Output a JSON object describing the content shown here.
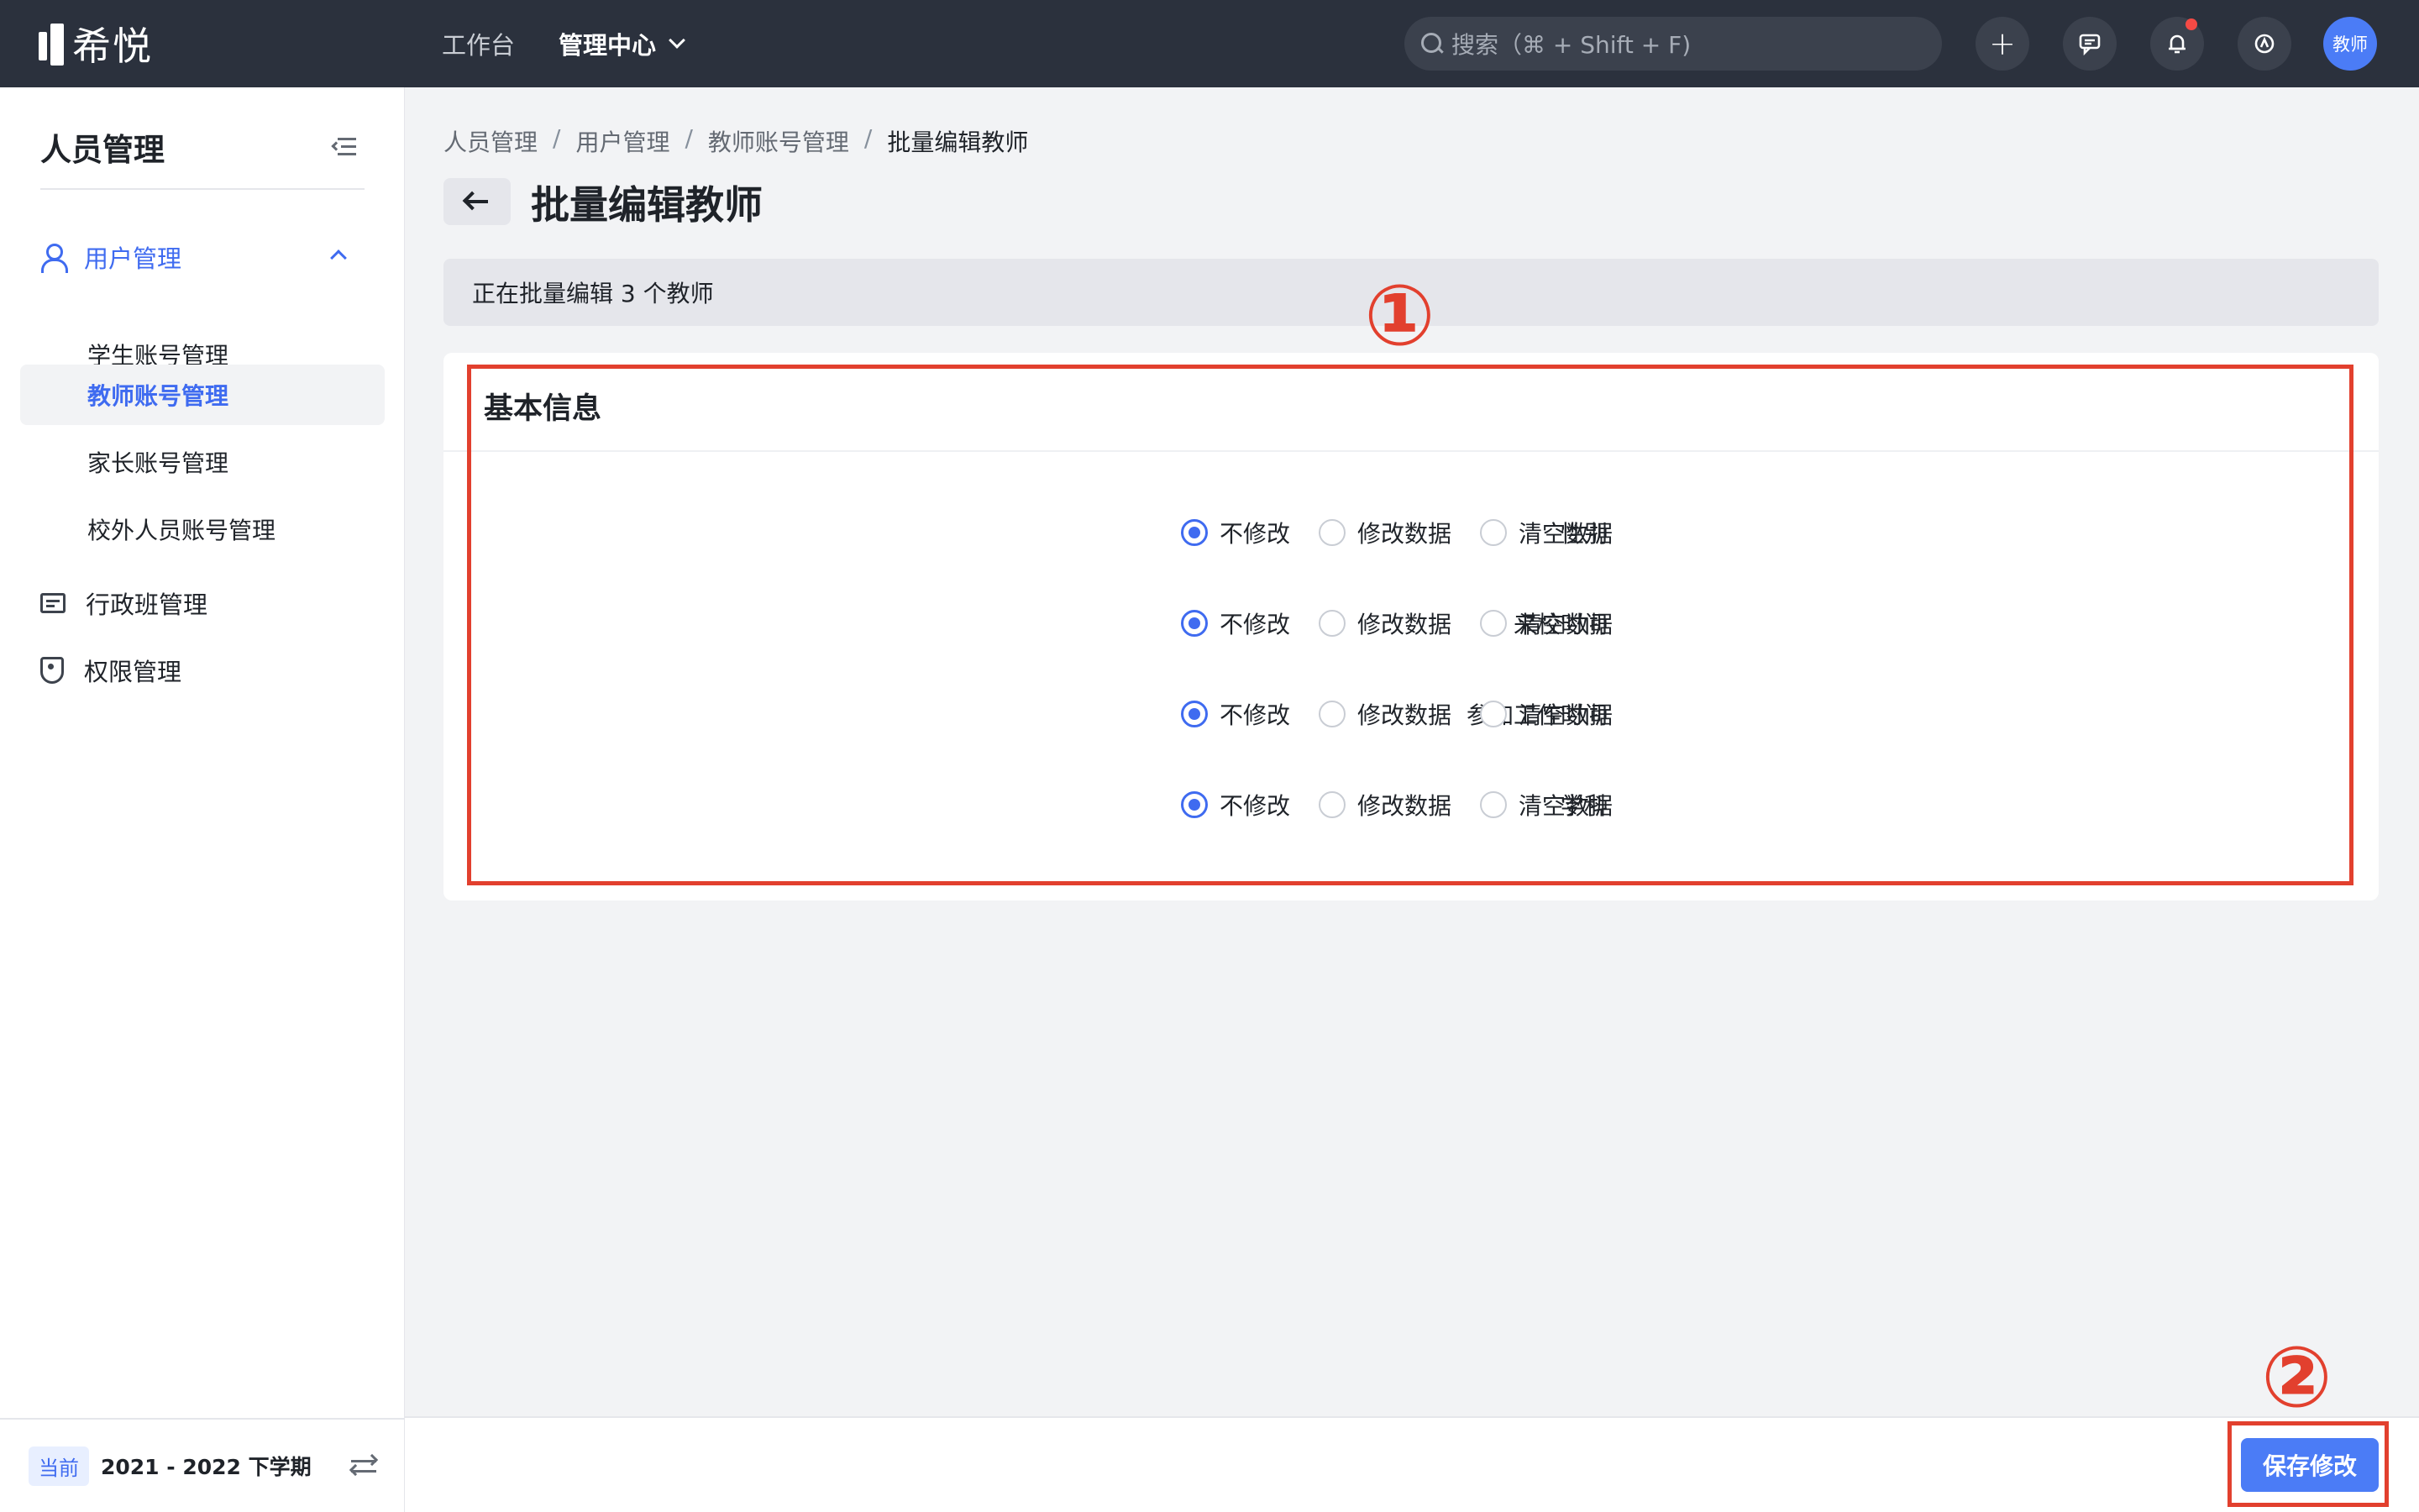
{
  "app": {
    "name": "希悦"
  },
  "topnav": {
    "items": [
      {
        "label": "工作台"
      },
      {
        "label": "管理中心"
      }
    ]
  },
  "search": {
    "placeholder": "搜索（⌘ + Shift + F)"
  },
  "user": {
    "avatar_label": "教师"
  },
  "sidebar": {
    "title": "人员管理",
    "group": {
      "label": "用户管理"
    },
    "sub_items": [
      {
        "label": "学生账号管理"
      },
      {
        "label": "教师账号管理"
      },
      {
        "label": "家长账号管理"
      },
      {
        "label": "校外人员账号管理"
      }
    ],
    "items": [
      {
        "label": "行政班管理",
        "icon": "class-icon"
      },
      {
        "label": "权限管理",
        "icon": "shield-icon"
      }
    ],
    "term": {
      "badge": "当前",
      "text": "2021 - 2022 下学期"
    }
  },
  "breadcrumb": [
    "人员管理",
    "用户管理",
    "教师账号管理",
    "批量编辑教师"
  ],
  "page": {
    "title": "批量编辑教师",
    "info": "正在批量编辑 3 个教师"
  },
  "card": {
    "title": "基本信息",
    "options": [
      "不修改",
      "修改数据",
      "清空数据"
    ],
    "fields": [
      {
        "label": "性别",
        "selected": "不修改"
      },
      {
        "label": "来校时间",
        "selected": "不修改"
      },
      {
        "label": "参加工作时间",
        "selected": "不修改"
      },
      {
        "label": "学科",
        "selected": "不修改"
      }
    ]
  },
  "annotations": [
    "①",
    "②"
  ],
  "footer": {
    "save_label": "保存修改"
  },
  "colors": {
    "accent": "#3f6bf0",
    "topbar": "#2b313d",
    "annotation": "#e2402e"
  }
}
